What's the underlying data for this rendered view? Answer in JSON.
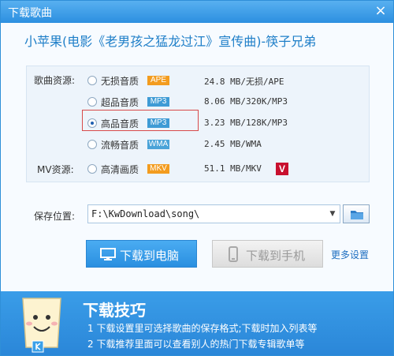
{
  "window": {
    "title": "下载歌曲",
    "close_glyph": "×"
  },
  "song": {
    "title": "小苹果(电影《老男孩之猛龙过江》宣传曲)-筷子兄弟"
  },
  "sections": {
    "song_source_label": "歌曲资源:",
    "mv_source_label": "MV资源:"
  },
  "qualities": [
    {
      "name": "无损音质",
      "badge": "APE",
      "info": "24.8 MB/无损/APE",
      "selected": false
    },
    {
      "name": "超品音质",
      "badge": "MP3",
      "info": "8.06 MB/320K/MP3",
      "selected": false
    },
    {
      "name": "高品音质",
      "badge": "MP3",
      "info": "3.23 MB/128K/MP3",
      "selected": true
    },
    {
      "name": "流畅音质",
      "badge": "WMA",
      "info": "2.45 MB/WMA",
      "selected": false
    }
  ],
  "mv": {
    "name": "高清画质",
    "badge": "MKV",
    "info": "51.1 MB/MKV",
    "vip_badge": "V"
  },
  "save": {
    "label": "保存位置:",
    "path": "F:\\KwDownload\\song\\"
  },
  "buttons": {
    "download_pc": "下载到电脑",
    "download_phone": "下载到手机",
    "more_settings": "更多设置"
  },
  "tips": {
    "title": "下载技巧",
    "line1": "1 下载设置里可选择歌曲的保存格式;下载时加入列表等",
    "line2": "2 下载推荐里面可以查看别人的热门下载专辑歌单等"
  },
  "colors": {
    "accent": "#2c8fe0",
    "badge_orange": "#f39c1f",
    "badge_blue": "#3e9bd5",
    "highlight_red": "#d84a4a"
  }
}
